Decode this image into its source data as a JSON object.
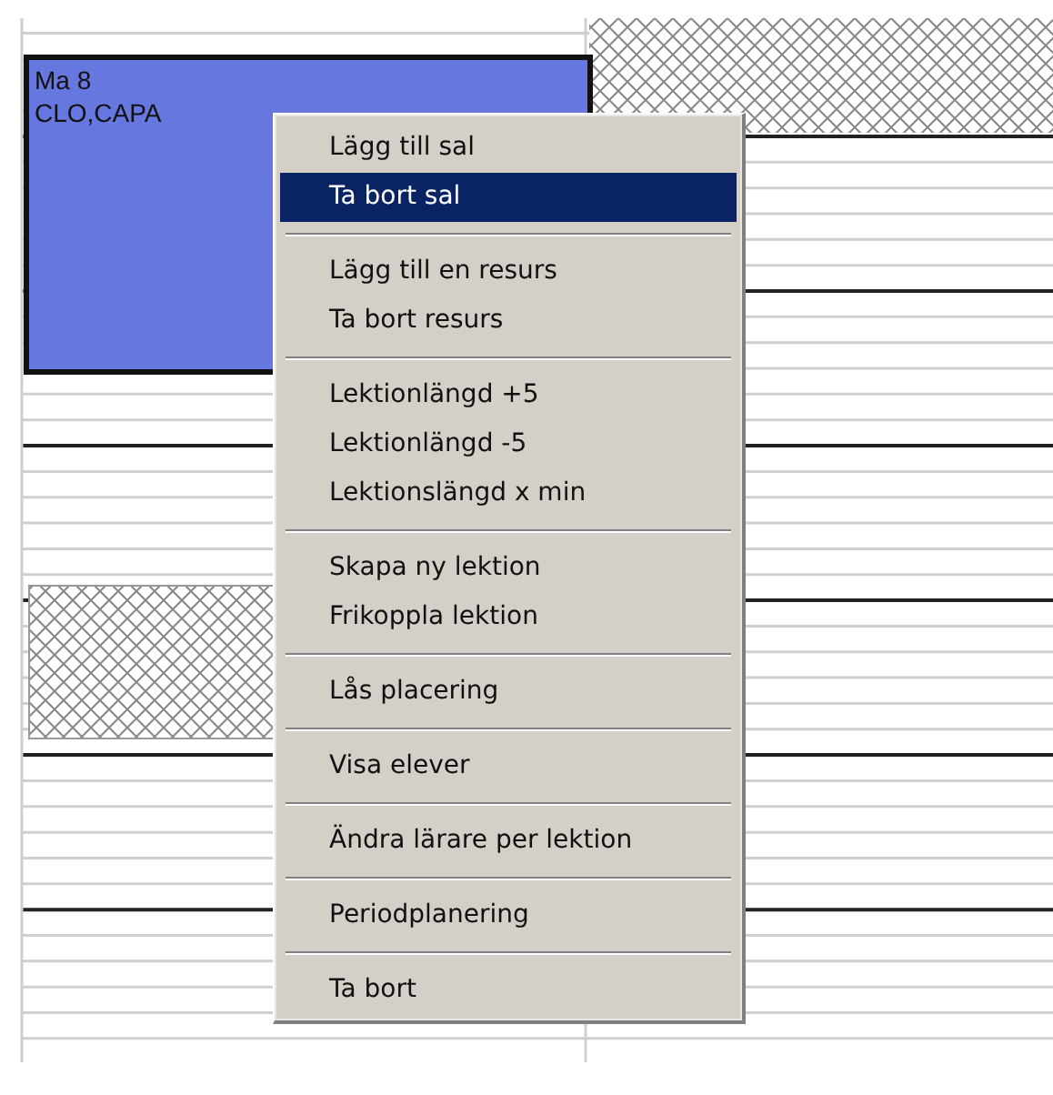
{
  "lesson": {
    "lines": [
      "Ma 8",
      "CLO,CAPA"
    ]
  },
  "context_menu": {
    "groups": [
      {
        "items": [
          {
            "label": "Lägg till sal",
            "selected": false
          },
          {
            "label": "Ta bort sal",
            "selected": true
          }
        ]
      },
      {
        "items": [
          {
            "label": "Lägg till en resurs",
            "selected": false
          },
          {
            "label": "Ta bort resurs",
            "selected": false
          }
        ]
      },
      {
        "items": [
          {
            "label": "Lektionlängd +5",
            "selected": false
          },
          {
            "label": "Lektionlängd -5",
            "selected": false
          },
          {
            "label": "Lektionslängd x min",
            "selected": false
          }
        ]
      },
      {
        "items": [
          {
            "label": "Skapa ny lektion",
            "selected": false
          },
          {
            "label": "Frikoppla lektion",
            "selected": false
          }
        ]
      },
      {
        "items": [
          {
            "label": "Lås placering",
            "selected": false
          }
        ]
      },
      {
        "items": [
          {
            "label": "Visa elever",
            "selected": false
          }
        ]
      },
      {
        "items": [
          {
            "label": "Ändra lärare per lektion",
            "selected": false
          }
        ]
      },
      {
        "items": [
          {
            "label": "Periodplanering",
            "selected": false
          }
        ]
      },
      {
        "items": [
          {
            "label": "Ta bort",
            "selected": false
          }
        ]
      }
    ]
  }
}
